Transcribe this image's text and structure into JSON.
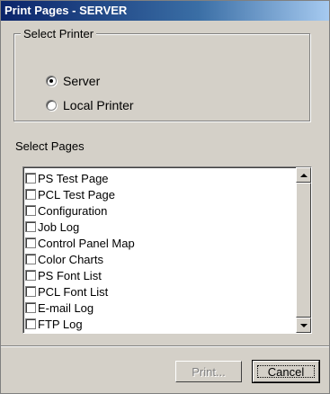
{
  "window": {
    "title": "Print Pages - SERVER"
  },
  "select_printer": {
    "legend": "Select Printer",
    "options": [
      {
        "label": "Server",
        "checked": true
      },
      {
        "label": "Local Printer",
        "checked": false
      }
    ]
  },
  "select_pages": {
    "label": "Select Pages",
    "items": [
      {
        "label": "PS Test Page",
        "checked": false
      },
      {
        "label": "PCL Test Page",
        "checked": false
      },
      {
        "label": "Configuration",
        "checked": false
      },
      {
        "label": "Job Log",
        "checked": false
      },
      {
        "label": "Control Panel Map",
        "checked": false
      },
      {
        "label": "Color Charts",
        "checked": false
      },
      {
        "label": "PS Font List",
        "checked": false
      },
      {
        "label": "PCL Font List",
        "checked": false
      },
      {
        "label": "E-mail Log",
        "checked": false
      },
      {
        "label": "FTP Log",
        "checked": false
      }
    ]
  },
  "buttons": {
    "print": "Print...",
    "cancel": "Cancel"
  }
}
